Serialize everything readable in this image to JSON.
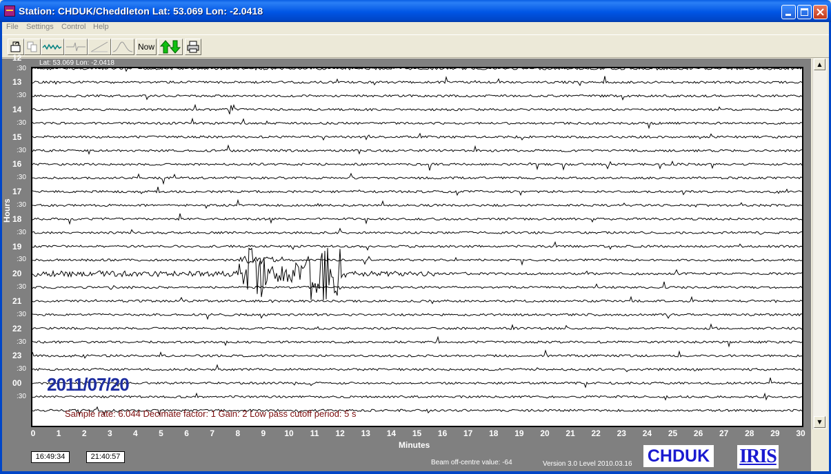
{
  "window": {
    "title": "Station: CHDUK/Cheddleton Lat: 53.069 Lon: -2.0418",
    "minimize": "_",
    "maximize": "□",
    "close": "✕"
  },
  "menu": [
    "File",
    "Settings",
    "Control",
    "Help"
  ],
  "toolbar": {
    "now_label": "Now",
    "icons": [
      "open-file-icon",
      "copy-icon",
      "waveform-icon",
      "filter-icon",
      "slope-icon",
      "bell-curve-icon",
      "up-down-arrows-icon",
      "printer-icon"
    ]
  },
  "plot": {
    "latlon": "Lat: 53.069 Lon: -2.0418",
    "top_partial_hour": "12",
    "hour_labels": [
      "13",
      "14",
      "15",
      "16",
      "17",
      "18",
      "19",
      "20",
      "21",
      "22",
      "23",
      "00"
    ],
    "half_label": ":30",
    "y_axis_label": "Hours",
    "x_axis_label": "Minutes",
    "x_ticks": [
      "0",
      "1",
      "2",
      "3",
      "4",
      "5",
      "6",
      "7",
      "8",
      "9",
      "10",
      "11",
      "12",
      "13",
      "14",
      "15",
      "16",
      "17",
      "18",
      "19",
      "20",
      "21",
      "22",
      "23",
      "24",
      "25",
      "26",
      "27",
      "28",
      "29",
      "30"
    ],
    "date": "2011/07/20",
    "info": "Sample rate: 6.044  Decimate factor: 1  Gain: 2  Low pass cutoff period: 5 s",
    "trace_color": "#000000",
    "earthquake": {
      "trace_hour": "20",
      "start_minute": 8,
      "end_minute": 12.5
    }
  },
  "footer": {
    "start_time": "16:49:34",
    "end_time": "21:40:57",
    "beam_text": "Beam off-centre value: -64",
    "version_text": "Version 3.0 Level 2010.03.16",
    "station_logo": "CHDUK",
    "iris_logo": "IRIS"
  },
  "colors": {
    "panel": "#808080",
    "date": "#1e2ea0",
    "info": "#7a0a0a",
    "title_bar": "#0055e5"
  }
}
